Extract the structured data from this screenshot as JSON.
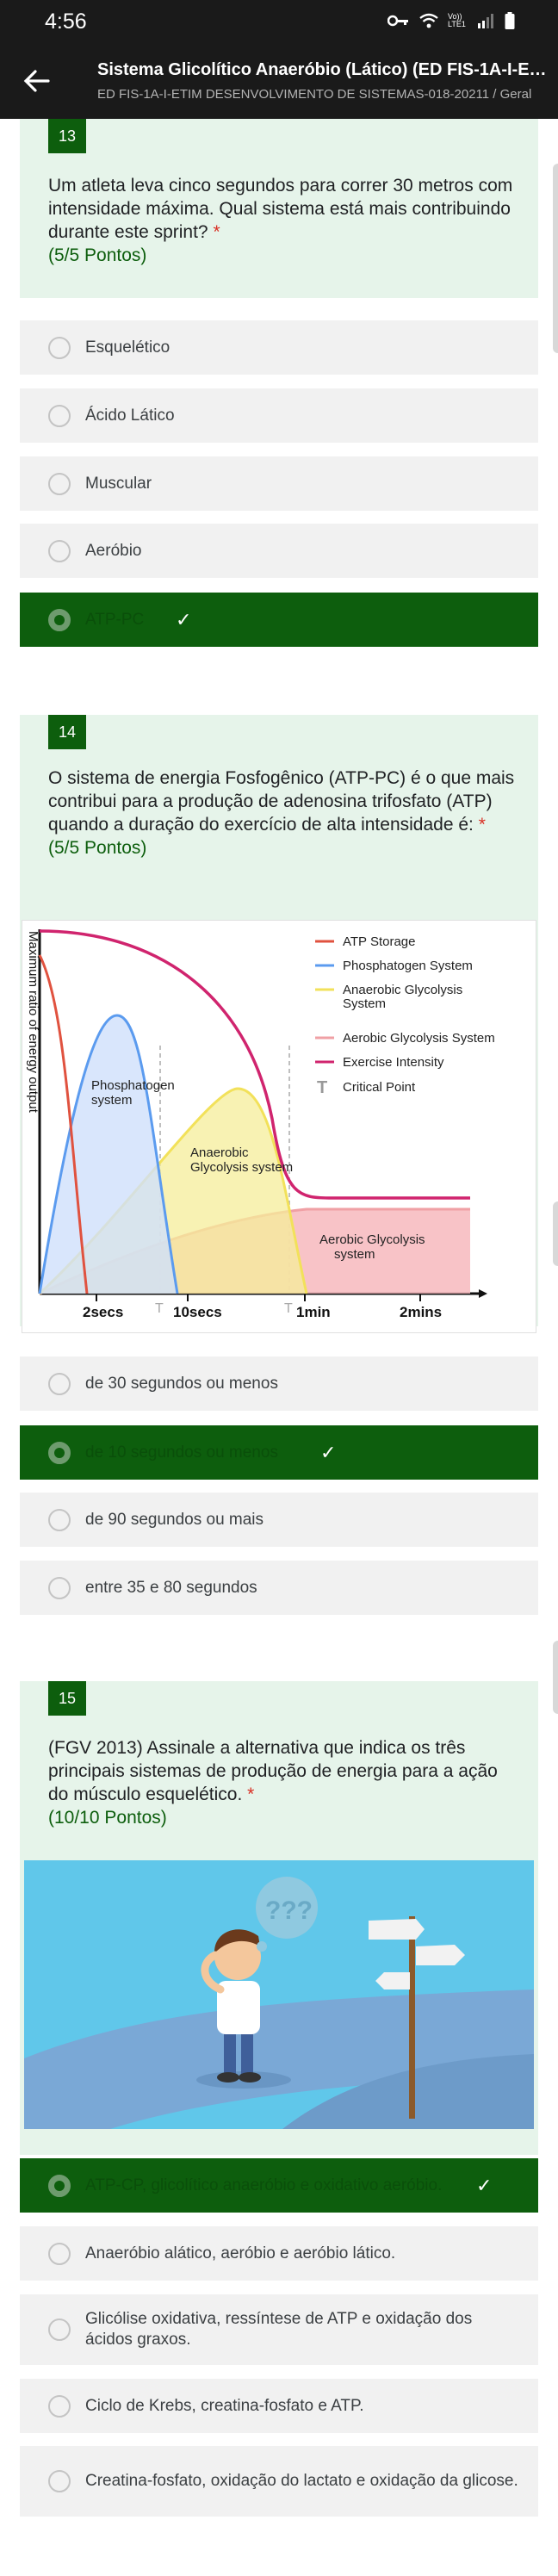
{
  "status_bar": {
    "time": "4:56",
    "network": "Vo)) LTE1"
  },
  "app_bar": {
    "title": "Sistema Glicolítico Anaeróbio (Lático) (ED FIS-1A-I-ETIM ...",
    "subtitle": "ED FIS-1A-I-ETIM DESENVOLVIMENTO DE SISTEMAS-018-20211 / Geral"
  },
  "questions": [
    {
      "number": "13",
      "text": "Um atleta leva cinco segundos para correr 30 metros com intensidade máxima. Qual sistema está mais contribuindo durante este sprint?",
      "required": "*",
      "points": "(5/5 Pontos)",
      "options": [
        "Esquelético",
        "Ácido Lático",
        "Muscular",
        "Aeróbio",
        "ATP-PC"
      ],
      "check": "✓"
    },
    {
      "number": "14",
      "text": "O sistema de energia Fosfogênico (ATP-PC) é o que mais contribui para a produção de adenosina trifosfato (ATP) quando a duração do exercício de alta intensidade é:",
      "required": "*",
      "points": "(5/5 Pontos)",
      "options": [
        "de 30 segundos ou menos",
        "de 10 segundos ou menos",
        "de 90 segundos ou mais",
        "entre 35 e 80 segundos"
      ],
      "check": "✓"
    },
    {
      "number": "15",
      "text": "(FGV 2013) Assinale a alternativa que indica os três principais sistemas de produção de energia para a ação do músculo esquelético.",
      "required": "*",
      "points": "(10/10 Pontos)",
      "options": [
        "ATP-CP, glicolítico anaeróbio e oxidativo aeróbio.",
        "Anaeróbio alático, aeróbio e aeróbio lático.",
        "Glicólise oxidativa, ressíntese de ATP e oxidação dos ácidos graxos.",
        "Ciclo de Krebs, creatina-fosfato e ATP.",
        "Creatina-fosfato, oxidação do lactato e oxidação da glicose."
      ],
      "check": "✓"
    }
  ],
  "chart_data": {
    "type": "line",
    "ylabel": "Maximum ratio of energy output",
    "x_ticks": [
      "2secs",
      "10secs",
      "1min",
      "2mins"
    ],
    "critical_marker": "T",
    "legend": [
      {
        "name": "ATP Storage",
        "color": "#e0523f"
      },
      {
        "name": "Phosphatogen System",
        "color": "#5b9bef"
      },
      {
        "name": "Anaerobic Glycolysis System",
        "color": "#f2e15a"
      },
      {
        "name": "Aerobic Glycolysis System",
        "color": "#f0a0a5"
      },
      {
        "name": "Exercise Intensity",
        "color": "#d0246e"
      },
      {
        "name": "Critical Point",
        "color": "#999999"
      }
    ],
    "area_labels": {
      "phosphagen": "Phosphatogen system",
      "anaerobic": "Anaerobic Glycolysis system",
      "aerobic": "Aerobic Glycolysis system"
    }
  },
  "illustration": {
    "thought_symbols": "???"
  },
  "colors": {
    "accent": "#0d5e0d",
    "card_bg": "#e6f4ea",
    "option_bg": "#f1f1f1",
    "required": "#d93025"
  }
}
